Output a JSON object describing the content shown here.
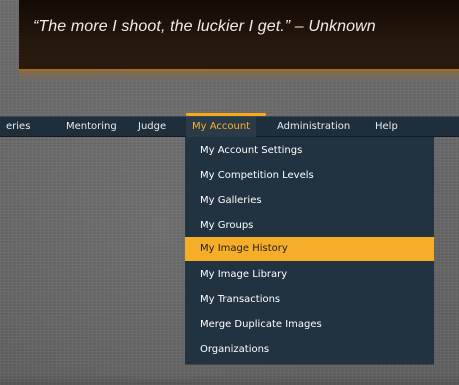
{
  "banner": {
    "quote": "“The more I shoot, the luckier I get.” – Unknown"
  },
  "nav": {
    "items": [
      {
        "label": "eries"
      },
      {
        "label": "Mentoring"
      },
      {
        "label": "Judge"
      },
      {
        "label": "My Account"
      },
      {
        "label": "Administration"
      },
      {
        "label": "Help"
      }
    ],
    "active": "My Account"
  },
  "dropdown": {
    "items": [
      {
        "label": "My Account Settings"
      },
      {
        "label": "My Competition Levels"
      },
      {
        "label": "My Galleries"
      },
      {
        "label": "My Groups"
      },
      {
        "label": "My Image History"
      },
      {
        "label": "My Image Library"
      },
      {
        "label": "My Transactions"
      },
      {
        "label": "Merge Duplicate Images"
      },
      {
        "label": "Organizations"
      }
    ],
    "highlighted": "My Image History"
  },
  "colors": {
    "accent": "#f6ae28",
    "nav_bg": "#1f2e3b",
    "menu_bg": "#213241",
    "banner_bg": "#1d1209"
  }
}
